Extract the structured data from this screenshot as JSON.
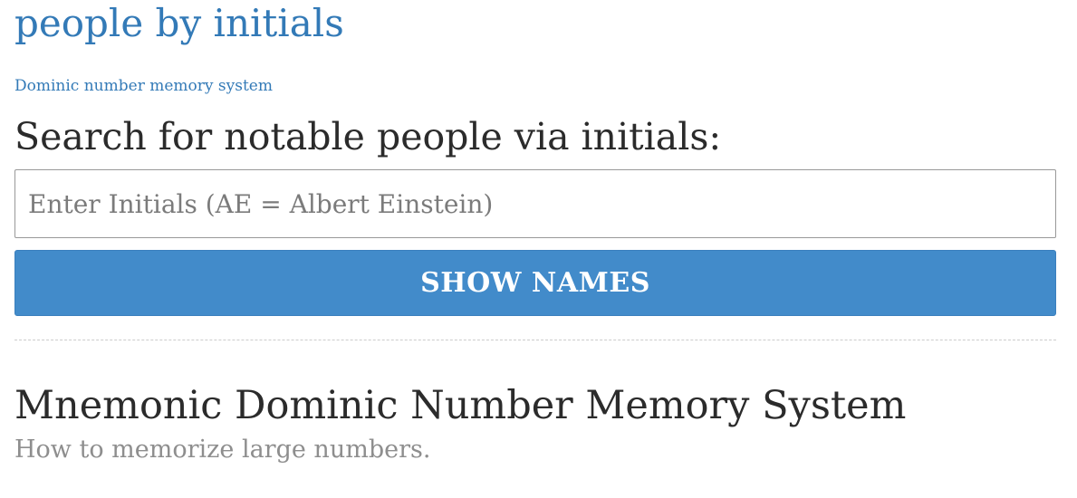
{
  "header": {
    "site_title": "people by initials",
    "site_subtitle": "Dominic number memory system"
  },
  "search": {
    "heading": "Search for notable people via initials:",
    "placeholder": "Enter Initials (AE = Albert Einstein)",
    "value": "",
    "button_label": "SHOW NAMES"
  },
  "article": {
    "title": "Mnemonic Dominic Number Memory System",
    "subtitle": "How to memorize large numbers."
  },
  "colors": {
    "link": "#337ab7",
    "button_bg": "#428bca",
    "heading_text": "#2b2b2b",
    "muted_text": "#8e8e8e"
  }
}
